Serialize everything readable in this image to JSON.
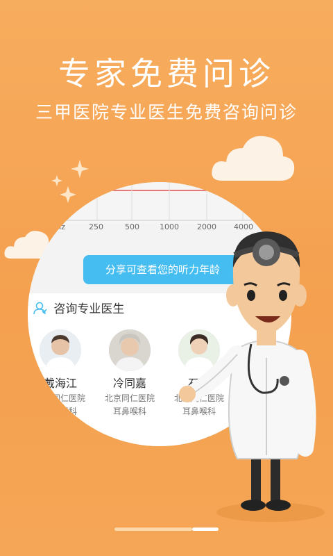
{
  "header": {
    "title": "专家免费问诊",
    "subtitle": "三甲医院专业医生免费咨询问诊"
  },
  "phone_preview": {
    "chart_ticks": [
      "Hz",
      "250",
      "500",
      "1000",
      "2000",
      "4000"
    ],
    "share_button": "分享可查看您的听力年龄",
    "consult_section": {
      "heading": "咨询专业医生",
      "doctors": [
        {
          "name": "戴海江",
          "hospital": "北京同仁医院",
          "department": "耳鼻喉科"
        },
        {
          "name": "冷同嘉",
          "hospital": "北京同仁医院",
          "department": "耳鼻喉科"
        },
        {
          "name": "石蕾",
          "hospital": "北京同仁医院",
          "department": "耳鼻喉科"
        }
      ]
    }
  },
  "colors": {
    "background": "#f5a556",
    "accent_blue": "#46bdf1",
    "text_white": "#ffffff"
  },
  "page_indicator": {
    "total": 4,
    "active": 3
  }
}
